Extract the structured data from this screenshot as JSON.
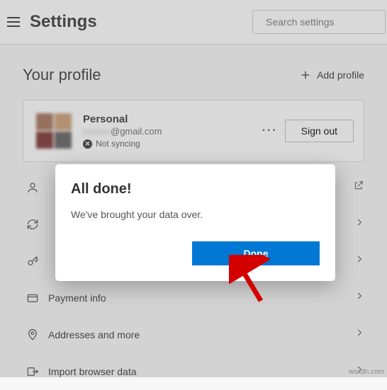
{
  "header": {
    "title": "Settings",
    "search_placeholder": "Search settings"
  },
  "profile_section": {
    "heading": "Your profile",
    "add_label": "Add profile"
  },
  "profile_card": {
    "name": "Personal",
    "email_suffix": "@gmail.com",
    "sync_status": "Not syncing",
    "signout_label": "Sign out",
    "more_label": "···"
  },
  "menu": {
    "items": [
      {
        "icon": "user-icon",
        "label": "",
        "action": "external"
      },
      {
        "icon": "sync-icon",
        "label": "",
        "action": "chevron"
      },
      {
        "icon": "key-icon",
        "label": "",
        "action": "chevron"
      },
      {
        "icon": "card-icon",
        "label": "Payment info",
        "action": "chevron"
      },
      {
        "icon": "pin-icon",
        "label": "Addresses and more",
        "action": "chevron"
      },
      {
        "icon": "import-icon",
        "label": "Import browser data",
        "action": "chevron"
      }
    ]
  },
  "dialog": {
    "title": "All done!",
    "body": "We've brought your data over.",
    "done_label": "Done"
  },
  "watermark": "wsxdn.com"
}
